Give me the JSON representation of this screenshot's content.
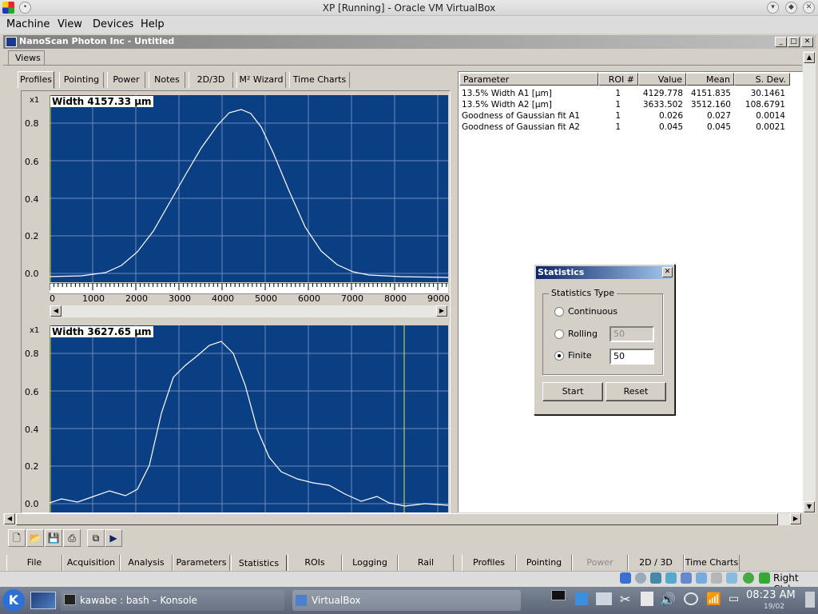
{
  "host": {
    "title": "XP [Running] - Oracle VM VirtualBox",
    "menu": [
      "Machine",
      "View",
      "Devices",
      "Help"
    ],
    "host_key": "Right Ctrl"
  },
  "app": {
    "title": "NanoScan Photon Inc - Untitled",
    "views_tab": "Views",
    "top_tabs": [
      "Profiles",
      "Pointing",
      "Power",
      "Notes",
      "2D/3D",
      "M² Wizard",
      "Time Charts"
    ],
    "active_top_tab": "Profiles",
    "bottom_tabs": [
      "File",
      "Acquisition",
      "Analysis",
      "Parameters",
      "Statistics",
      "ROIs",
      "Logging",
      "Rail",
      "Profiles",
      "Pointing",
      "Power",
      "2D / 3D",
      "Time Charts"
    ],
    "active_bottom_tab": "Statistics",
    "disabled_bottom_tab": "Power"
  },
  "plots": [
    {
      "label": "Width 4157.33 µm",
      "scale": "x1",
      "yticks": [
        "0.8",
        "0.6",
        "0.4",
        "0.2",
        "0.0"
      ],
      "xticks": [
        "0",
        "1000",
        "2000",
        "3000",
        "4000",
        "5000",
        "6000",
        "7000",
        "8000",
        "9000"
      ]
    },
    {
      "label": "Width 3627.65 µm",
      "scale": "x1",
      "yticks": [
        "0.8",
        "0.6",
        "0.4",
        "0.2",
        "0.0"
      ]
    }
  ],
  "stats_table": {
    "headers": [
      "Parameter",
      "ROI #",
      "Value",
      "Mean",
      "S. Dev."
    ],
    "rows": [
      [
        "13.5% Width A1 [µm]",
        "1",
        "4129.778",
        "4151.835",
        "30.1461"
      ],
      [
        "13.5% Width A2 [µm]",
        "1",
        "3633.502",
        "3512.160",
        "108.6791"
      ],
      [
        "Goodness of Gaussian fit A1",
        "1",
        "0.026",
        "0.027",
        "0.0014"
      ],
      [
        "Goodness of Gaussian fit A2",
        "1",
        "0.045",
        "0.045",
        "0.0021"
      ]
    ]
  },
  "dialog": {
    "title": "Statistics",
    "group": "Statistics Type",
    "options": [
      "Continuous",
      "Rolling",
      "Finite"
    ],
    "selected": "Finite",
    "rolling_value": "50",
    "finite_value": "50",
    "start": "Start",
    "reset": "Reset"
  },
  "taskbar": {
    "konsole": "kawabe : bash – Konsole",
    "virtualbox": "VirtualBox",
    "time": "08:23 AM",
    "date": "19/02"
  }
}
